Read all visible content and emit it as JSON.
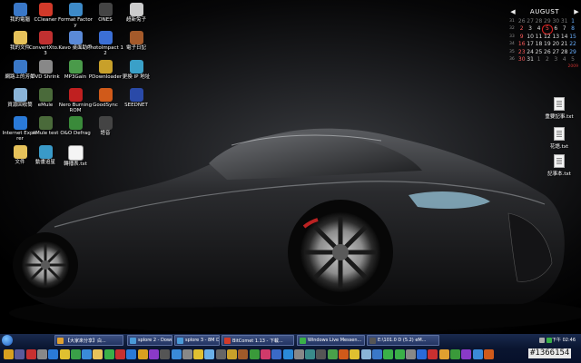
{
  "desktop_icons": [
    {
      "label": "我的電腦",
      "icon": "my-computer-icon",
      "color": "#3a78c8"
    },
    {
      "label": "CCleaner",
      "icon": "ccleaner-icon",
      "color": "#d23a2a"
    },
    {
      "label": "Format Factory",
      "icon": "format-factory-icon",
      "color": "#3d8ac8"
    },
    {
      "label": "ONES",
      "icon": "ones-icon",
      "color": "#444"
    },
    {
      "label": "超新兔子",
      "icon": "rabbit-icon",
      "color": "#ccc"
    },
    {
      "label": "我的文件",
      "icon": "my-documents-icon",
      "color": "#e6c25a"
    },
    {
      "label": "ConvertXto... 3",
      "icon": "convertxto-icon",
      "color": "#c03030"
    },
    {
      "label": "Kavo 桌面助手",
      "icon": "kavo-icon",
      "color": "#5a8ad8"
    },
    {
      "label": "PhotoImpact 12",
      "icon": "photoimpact-icon",
      "color": "#3b6fd6"
    },
    {
      "label": "電子日記",
      "icon": "diary-icon",
      "color": "#a55a2a"
    },
    {
      "label": "網路上的芳鄰",
      "icon": "network-icon",
      "color": "#3a78c8"
    },
    {
      "label": "DVD Shrink",
      "icon": "dvd-shrink-icon",
      "color": "#888"
    },
    {
      "label": "MP3Gain",
      "icon": "mp3gain-icon",
      "color": "#4a9a4a"
    },
    {
      "label": "PDownloader",
      "icon": "pdownloader-icon",
      "color": "#c8a02a"
    },
    {
      "label": "更換 IP 地址",
      "icon": "ip-change-icon",
      "color": "#3aa0c8"
    },
    {
      "label": "資源回收筒",
      "icon": "recycle-bin-icon",
      "color": "#8ab4d8"
    },
    {
      "label": "eMule",
      "icon": "emule-icon",
      "color": "#4a6a3a"
    },
    {
      "label": "Nero Burning ROM",
      "icon": "nero-icon",
      "color": "#c02020"
    },
    {
      "label": "GoodSync",
      "icon": "goodsync-icon",
      "color": "#d05a1a"
    },
    {
      "label": "SEEDNET",
      "icon": "seednet-icon",
      "color": "#2a4aa8"
    },
    {
      "label": "Internet Explorer",
      "icon": "internet-explorer-icon",
      "color": "#2a7ad8"
    },
    {
      "label": "eMule test",
      "icon": "emule-test-icon",
      "color": "#4a6a3a"
    },
    {
      "label": "O&O Defrag",
      "icon": "defrag-icon",
      "color": "#3a8a3a"
    },
    {
      "label": "語音",
      "icon": "voice-icon",
      "color": "#444"
    },
    {
      "label": "文件",
      "icon": "folder-icon",
      "color": "#e6c25a"
    },
    {
      "label": "動畫追星",
      "icon": "anime-icon",
      "color": "#3a9ac8"
    },
    {
      "label": "轉播表.txt",
      "icon": "text-file-icon",
      "color": "#f4f4f4"
    }
  ],
  "right_files": [
    {
      "label": "重要記事.txt"
    },
    {
      "label": "花語.txt"
    },
    {
      "label": "記事本.txt"
    }
  ],
  "calendar": {
    "prev": "◀",
    "next": "▶",
    "month": "AUGUST",
    "year": "2009",
    "rows": [
      {
        "wk": "31",
        "days": [
          "26",
          "27",
          "28",
          "29",
          "30",
          "31",
          "1"
        ]
      },
      {
        "wk": "32",
        "days": [
          "2",
          "3",
          "4",
          "5",
          "6",
          "7",
          "8"
        ]
      },
      {
        "wk": "33",
        "days": [
          "9",
          "10",
          "11",
          "12",
          "13",
          "14",
          "15"
        ]
      },
      {
        "wk": "34",
        "days": [
          "16",
          "17",
          "18",
          "19",
          "20",
          "21",
          "22"
        ]
      },
      {
        "wk": "35",
        "days": [
          "23",
          "24",
          "25",
          "26",
          "27",
          "28",
          "29"
        ]
      },
      {
        "wk": "36",
        "days": [
          "30",
          "31",
          "1",
          "2",
          "3",
          "4",
          "5"
        ]
      }
    ]
  },
  "taskbar": {
    "tasks": [
      {
        "label": "【大家來分享】白...",
        "color": "#e0a030"
      },
      {
        "label": "splore 2 - Download...",
        "color": "#4a9ad8"
      },
      {
        "label": "splore 3 - 8M DL 0...",
        "color": "#4a9ad8"
      },
      {
        "label": "BitComet 1.13 - 下載...",
        "color": "#d03a2a"
      },
      {
        "label": "Windows Live Messen...",
        "color": "#3ab048"
      },
      {
        "label": "E:\\101.0 D (5.2) eM...",
        "color": "#555"
      }
    ],
    "clock": "下午 02:46",
    "quick_launch": [
      {
        "icon": "media-icon",
        "color": "#d8a020"
      },
      {
        "icon": "gear-icon",
        "color": "#5a5a9a"
      },
      {
        "icon": "flag-icon",
        "color": "#c83030"
      },
      {
        "icon": "cd-icon",
        "color": "#888"
      },
      {
        "icon": "globe-icon",
        "color": "#2a7ad8"
      },
      {
        "icon": "star-icon",
        "color": "#e0c030"
      },
      {
        "icon": "music-icon",
        "color": "#3aa048"
      },
      {
        "icon": "chat-icon",
        "color": "#3a8ad8"
      },
      {
        "icon": "folder-icon",
        "color": "#e6c25a"
      },
      {
        "icon": "download-icon",
        "color": "#3ab048"
      },
      {
        "icon": "shield-icon",
        "color": "#c83030"
      },
      {
        "icon": "search-icon",
        "color": "#2a7ad8"
      },
      {
        "icon": "mail-icon",
        "color": "#d8a020"
      },
      {
        "icon": "video-icon",
        "color": "#8a3ac8"
      },
      {
        "icon": "camera-icon",
        "color": "#555"
      },
      {
        "icon": "phone-icon",
        "color": "#3a8ad8"
      },
      {
        "icon": "tool-icon",
        "color": "#888"
      },
      {
        "icon": "bolt-icon",
        "color": "#e0c030"
      },
      {
        "icon": "cloud-icon",
        "color": "#6ab0e8"
      },
      {
        "icon": "disk-icon",
        "color": "#666"
      },
      {
        "icon": "key-icon",
        "color": "#c8a02a"
      },
      {
        "icon": "book-icon",
        "color": "#a05a2a"
      },
      {
        "icon": "game-icon",
        "color": "#3a9a3a"
      },
      {
        "icon": "heart-icon",
        "color": "#d03a6a"
      },
      {
        "icon": "clock-icon",
        "color": "#3a6ac8"
      },
      {
        "icon": "wifi-icon",
        "color": "#2a8ad8"
      },
      {
        "icon": "lock-icon",
        "color": "#888"
      },
      {
        "icon": "pen-icon",
        "color": "#3a8a8a"
      },
      {
        "icon": "print-icon",
        "color": "#555"
      },
      {
        "icon": "map-icon",
        "color": "#4aa04a"
      },
      {
        "icon": "chart-icon",
        "color": "#d05a1a"
      },
      {
        "icon": "note-icon",
        "color": "#e0c030"
      },
      {
        "icon": "trash-icon",
        "color": "#8ab4d8"
      },
      {
        "icon": "user-icon",
        "color": "#3a78c8"
      },
      {
        "icon": "home-icon",
        "color": "#3ab048"
      },
      {
        "icon": "battery-icon",
        "color": "#3ab048"
      },
      {
        "icon": "volume-icon",
        "color": "#888"
      },
      {
        "icon": "app-icon",
        "color": "#2a6ad8"
      },
      {
        "icon": "app-icon",
        "color": "#c83030"
      },
      {
        "icon": "app-icon",
        "color": "#e0a030"
      },
      {
        "icon": "app-icon",
        "color": "#3a9a3a"
      },
      {
        "icon": "app-icon",
        "color": "#8a3ac8"
      },
      {
        "icon": "app-icon",
        "color": "#3a8ad8"
      },
      {
        "icon": "app-icon",
        "color": "#d05a1a"
      }
    ]
  },
  "watermark": "#1366154"
}
